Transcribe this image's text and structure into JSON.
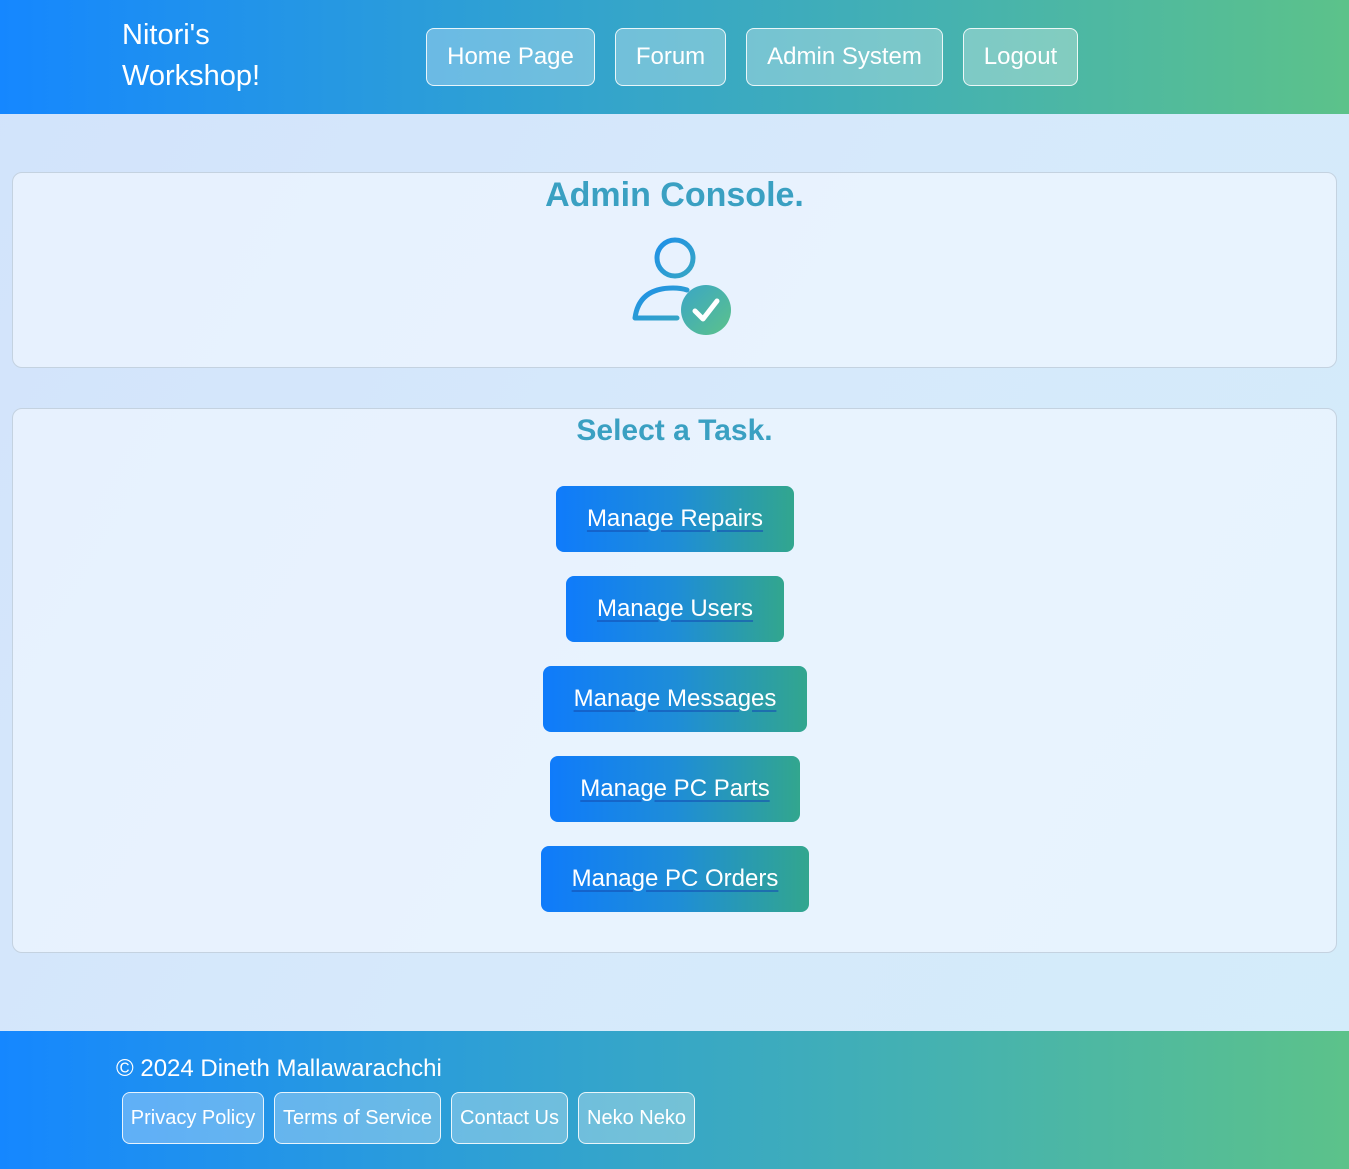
{
  "header": {
    "brand": "Nitori's Workshop!",
    "nav": [
      {
        "label": "Home Page"
      },
      {
        "label": "Forum"
      },
      {
        "label": "Admin System"
      },
      {
        "label": "Logout"
      }
    ]
  },
  "console": {
    "title": "Admin Console.",
    "icon": "user-check-icon"
  },
  "tasks": {
    "title": "Select a Task.",
    "buttons": [
      {
        "label": "Manage Repairs"
      },
      {
        "label": "Manage Users"
      },
      {
        "label": "Manage Messages"
      },
      {
        "label": "Manage PC Parts"
      },
      {
        "label": "Manage PC Orders"
      }
    ]
  },
  "footer": {
    "copyright": "© 2024 Dineth Mallawarachchi",
    "links": [
      {
        "label": "Privacy Policy"
      },
      {
        "label": "Terms of Service"
      },
      {
        "label": "Contact Us"
      },
      {
        "label": "Neko Neko"
      }
    ]
  },
  "colors": {
    "accent": "#3aa0c2",
    "gradient_start": "#1587ff",
    "gradient_end": "#5cc28a"
  }
}
